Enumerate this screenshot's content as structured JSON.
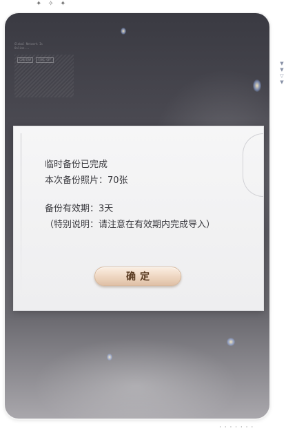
{
  "decorations": {
    "top_sparkles": "✦ ✧ ✦",
    "bottom_dots": "· · · · · · ·",
    "side_arrows": [
      "▼",
      "▼",
      "▽",
      "▼"
    ],
    "hud_lines": [
      "Global Network Is",
      "Online...",
      "CONFIRM",
      "SYNC OFF"
    ]
  },
  "dialog": {
    "line1": "临时备份已完成",
    "line2": "本次备份照片：70张",
    "line3": "备份有效期：3天",
    "line4": "（特别说明：请注意在有效期内完成导入）",
    "confirm_label": "确定"
  },
  "colors": {
    "backdrop_dark": "#3a3a42",
    "dialog_bg": "#f4f4f5",
    "text": "#3a3a3f",
    "button_top": "#fbeee2",
    "button_bottom": "#dfc0a6",
    "button_text": "#5a3b22"
  }
}
